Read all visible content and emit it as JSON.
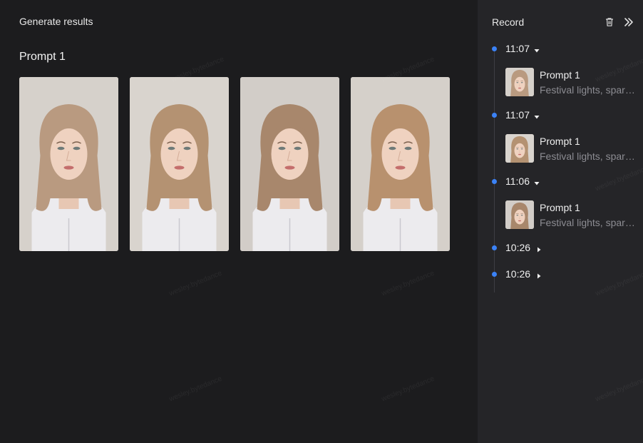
{
  "main": {
    "title": "Generate results",
    "prompt_title": "Prompt 1",
    "images": [
      {
        "alt": "Generated portrait 1"
      },
      {
        "alt": "Generated portrait 2"
      },
      {
        "alt": "Generated portrait 3"
      },
      {
        "alt": "Generated portrait 4"
      }
    ]
  },
  "sidebar": {
    "title": "Record",
    "delete_icon": "trash-icon",
    "collapse_icon": "double-chevron-right-icon",
    "entries": [
      {
        "time": "11:07",
        "expanded": true,
        "item": {
          "title": "Prompt 1",
          "desc": "Festival lights, sparkles"
        }
      },
      {
        "time": "11:07",
        "expanded": true,
        "item": {
          "title": "Prompt 1",
          "desc": "Festival lights, sparkles"
        }
      },
      {
        "time": "11:06",
        "expanded": true,
        "item": {
          "title": "Prompt 1",
          "desc": "Festival lights, sparkles"
        }
      },
      {
        "time": "10:26",
        "expanded": false
      },
      {
        "time": "10:26",
        "expanded": false
      }
    ]
  },
  "colors": {
    "accent": "#3b82f6",
    "background": "#1c1c1e",
    "sidebar": "#252528"
  }
}
